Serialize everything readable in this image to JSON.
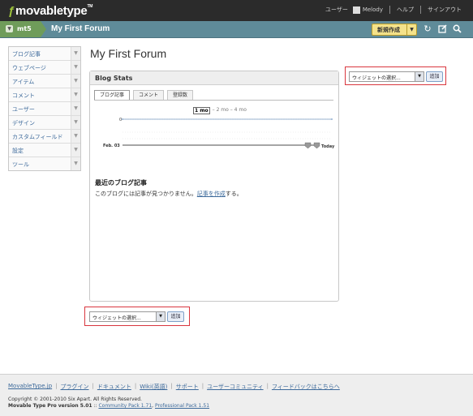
{
  "app": {
    "logo_text": "movabletype",
    "logo_tm": "TM"
  },
  "topnav": {
    "user_label": "ユーザー",
    "user_name": "Melody",
    "help": "ヘルプ",
    "signout": "サインアウト"
  },
  "subbar": {
    "blog_name": "mt5",
    "site_title": "My First Forum",
    "new_button": "新規作成"
  },
  "sidebar": {
    "items": [
      {
        "label": "ブログ記事"
      },
      {
        "label": "ウェブページ"
      },
      {
        "label": "アイテム"
      },
      {
        "label": "コメント"
      },
      {
        "label": "ユーザー"
      },
      {
        "label": "デザイン"
      },
      {
        "label": "カスタムフィールド"
      },
      {
        "label": "設定"
      },
      {
        "label": "ツール"
      }
    ]
  },
  "main": {
    "title": "My First Forum"
  },
  "widget_top": {
    "select_value": "ウィジェットの選択...",
    "add_label": "追加"
  },
  "widget_bottom": {
    "select_value": "ウィジェットの選択...",
    "add_label": "追加"
  },
  "stats": {
    "title": "Blog Stats",
    "tabs": [
      {
        "label": "ブログ記事",
        "active": true
      },
      {
        "label": "コメント",
        "active": false
      },
      {
        "label": "登録数",
        "active": false
      }
    ],
    "periods": {
      "p1": "1 mo",
      "p2": "2 mo",
      "p3": "4 mo",
      "sep": "–"
    },
    "recent_title": "最近のブログ記事",
    "recent_text": "このブログには記事が見つかりません。",
    "recent_link": "記事を作成",
    "recent_suffix": "する。"
  },
  "chart_data": {
    "type": "line",
    "x": [
      "Feb. 03",
      "Today"
    ],
    "series": [
      {
        "values": [
          0,
          0
        ]
      }
    ],
    "ytick": "0",
    "xstart": "Feb. 03",
    "xend": "Today"
  },
  "footer": {
    "links": [
      "MovableType.jp",
      "プラグイン",
      "ドキュメント",
      "Wiki(英語)",
      "サポート",
      "ユーザーコミュニティ",
      "フィードバックはこちらへ"
    ],
    "copyright": "Copyright © 2001-2010 Six Apart. All Rights Reserved.",
    "product": "Movable Type Pro",
    "version": "version 5.01",
    "sep": "::",
    "community_pack": "Community Pack 1.71",
    "professional_pack": "Professional Pack 1.51"
  },
  "colors": {
    "topbar": "#2b2b2b",
    "subbar": "#5f8b99",
    "blog_badge": "#6f9c5a",
    "widget_border": "#d9363e"
  }
}
